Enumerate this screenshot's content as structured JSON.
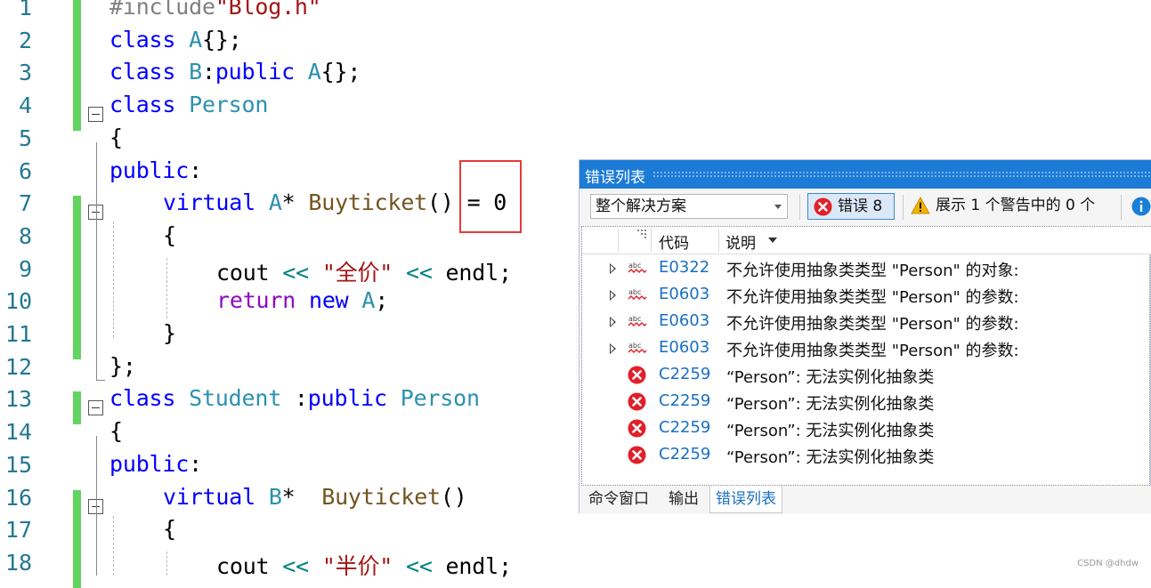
{
  "editor": {
    "lines": [
      {
        "n": "1",
        "tokens": [
          [
            "pp",
            "#include"
          ],
          [
            "str",
            "\"Blog.h\""
          ]
        ]
      },
      {
        "n": "2",
        "tokens": [
          [
            "kw",
            "class "
          ],
          [
            "ty",
            "A"
          ],
          [
            "",
            "{};"
          ]
        ]
      },
      {
        "n": "3",
        "tokens": [
          [
            "kw",
            "class "
          ],
          [
            "ty",
            "B"
          ],
          [
            "",
            ":"
          ],
          [
            "kw",
            "public "
          ],
          [
            "ty",
            "A"
          ],
          [
            "",
            "{};"
          ]
        ]
      },
      {
        "n": "4",
        "tokens": [
          [
            "kw",
            "class "
          ],
          [
            "ty",
            "Person"
          ]
        ]
      },
      {
        "n": "5",
        "tokens": [
          [
            "",
            "{"
          ]
        ]
      },
      {
        "n": "6",
        "tokens": [
          [
            "kw",
            "public"
          ],
          [
            "",
            ":"
          ]
        ]
      },
      {
        "n": "7",
        "tokens": [
          [
            "kw",
            "virtual "
          ],
          [
            "ty",
            "A"
          ],
          [
            "",
            "* "
          ],
          [
            "fn",
            "Buyticket"
          ],
          [
            "",
            "() = 0"
          ]
        ]
      },
      {
        "n": "8",
        "tokens": [
          [
            "",
            "{"
          ]
        ]
      },
      {
        "n": "9",
        "tokens": [
          [
            "",
            "cout "
          ],
          [
            "op",
            "<<"
          ],
          [
            "str",
            " \"全价\" "
          ],
          [
            "op",
            "<<"
          ],
          [
            "",
            " endl;"
          ]
        ]
      },
      {
        "n": "10",
        "tokens": [
          [
            "ctl",
            "return "
          ],
          [
            "kw",
            "new "
          ],
          [
            "ty",
            "A"
          ],
          [
            "",
            ";"
          ]
        ]
      },
      {
        "n": "11",
        "tokens": [
          [
            "",
            "}"
          ]
        ]
      },
      {
        "n": "12",
        "tokens": [
          [
            "",
            "};"
          ]
        ]
      },
      {
        "n": "13",
        "tokens": [
          [
            "kw",
            "class "
          ],
          [
            "ty",
            "Student "
          ],
          [
            "",
            ":"
          ],
          [
            "kw",
            "public "
          ],
          [
            "ty",
            "Person"
          ]
        ]
      },
      {
        "n": "14",
        "tokens": [
          [
            "",
            "{"
          ]
        ]
      },
      {
        "n": "15",
        "tokens": [
          [
            "kw",
            "public"
          ],
          [
            "",
            ":"
          ]
        ]
      },
      {
        "n": "16",
        "tokens": [
          [
            "kw",
            "virtual "
          ],
          [
            "ty",
            "B"
          ],
          [
            "",
            "*  "
          ],
          [
            "fn",
            "Buyticket"
          ],
          [
            "",
            "()"
          ]
        ]
      },
      {
        "n": "17",
        "tokens": [
          [
            "",
            "{"
          ]
        ]
      },
      {
        "n": "18",
        "tokens": [
          [
            "",
            "cout "
          ],
          [
            "op",
            "<<"
          ],
          [
            "str",
            " \"半价\" "
          ],
          [
            "op",
            "<<"
          ],
          [
            "",
            " endl;"
          ]
        ]
      }
    ]
  },
  "panel": {
    "title": "错误列表",
    "scope": "整个解决方案",
    "errors_label": "错误 8",
    "warnings_label": "展示 1 个警告中的 0 个",
    "col_code": "代码",
    "col_desc": "说明",
    "rows": [
      {
        "kind": "intellisense",
        "code": "E0322",
        "desc": "不允许使用抽象类类型 \"Person\" 的对象:"
      },
      {
        "kind": "intellisense",
        "code": "E0603",
        "desc": "不允许使用抽象类类型 \"Person\" 的参数:"
      },
      {
        "kind": "intellisense",
        "code": "E0603",
        "desc": "不允许使用抽象类类型 \"Person\" 的参数:"
      },
      {
        "kind": "intellisense",
        "code": "E0603",
        "desc": "不允许使用抽象类类型 \"Person\" 的参数:"
      },
      {
        "kind": "error",
        "code": "C2259",
        "desc": "“Person”: 无法实例化抽象类"
      },
      {
        "kind": "error",
        "code": "C2259",
        "desc": "“Person”: 无法实例化抽象类"
      },
      {
        "kind": "error",
        "code": "C2259",
        "desc": "“Person”: 无法实例化抽象类"
      },
      {
        "kind": "error",
        "code": "C2259",
        "desc": "“Person”: 无法实例化抽象类"
      }
    ],
    "tabs": [
      "命令窗口",
      "输出",
      "错误列表"
    ],
    "active_tab": "错误列表"
  },
  "watermark": "CSDN @dhdw",
  "colors": {
    "accent": "#1c7bd6",
    "error": "#e0202a",
    "warning": "#f2b200",
    "changebar": "#61d461",
    "highlight_box": "#e43a3a"
  }
}
